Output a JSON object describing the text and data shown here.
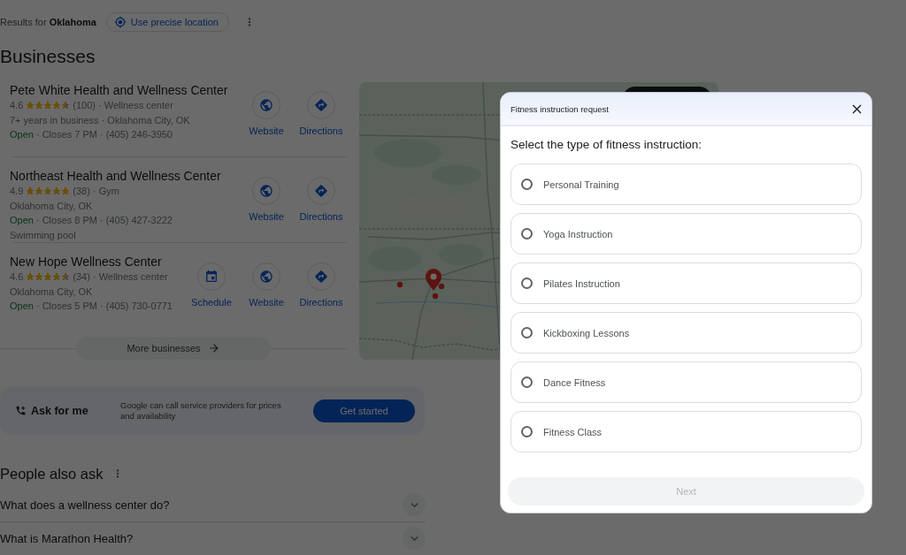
{
  "location_bar": {
    "text": "Results for **Oklahoma**",
    "precise_button": "Use precise location"
  },
  "businesses_heading": "Businesses",
  "businesses": [
    {
      "name": "Pete White Health and Wellness Center",
      "rating": "4.6",
      "stars": 4.5,
      "review_line": "(100) · Wellness center",
      "lines": [
        {
          "kind": "text",
          "text": "7+ years in business · Oklahoma City, OK"
        },
        {
          "kind": "hours",
          "status": "Open",
          "open": true,
          "text": "· Closes 7 PM · (405) 246-3950"
        }
      ],
      "actions": [
        {
          "kind": "website",
          "label": "Website"
        },
        {
          "kind": "directions",
          "label": "Directions"
        }
      ]
    },
    {
      "name": "Northeast Health and Wellness Center",
      "rating": "4.9",
      "stars": 5,
      "review_line": "(38) · Gym",
      "lines": [
        {
          "kind": "text",
          "text": "Oklahoma City, OK"
        },
        {
          "kind": "hours",
          "status": "Open",
          "open": true,
          "text": "· Closes 8 PM · (405) 427-3222"
        },
        {
          "kind": "text",
          "text": "Swimming pool"
        }
      ],
      "actions": [
        {
          "kind": "website",
          "label": "Website"
        },
        {
          "kind": "directions",
          "label": "Directions"
        }
      ]
    },
    {
      "name": "New Hope Wellness Center",
      "rating": "4.6",
      "stars": 4.5,
      "review_line": "(34) · Wellness center",
      "lines": [
        {
          "kind": "text",
          "text": "Oklahoma City, OK"
        },
        {
          "kind": "hours",
          "status": "Open",
          "open": true,
          "text": "· Closes 5 PM · (405) 730-0771"
        }
      ],
      "actions": [
        {
          "kind": "schedule",
          "label": "Schedule"
        },
        {
          "kind": "website",
          "label": "Website"
        },
        {
          "kind": "directions",
          "label": "Directions"
        }
      ]
    }
  ],
  "more_businesses_button": "More businesses",
  "ask_for_me": {
    "title": "Ask for me",
    "description": "Google can call service providers for prices and availability",
    "button": "Get started"
  },
  "people_also_ask": {
    "heading": "People also ask",
    "questions": [
      {
        "text": "What does a wellness center do?",
        "expanded": false
      },
      {
        "text": "What is Marathon Health?",
        "expanded": false
      }
    ]
  },
  "dialog": {
    "title": "Fitness instruction request",
    "prompt": "Select the type of fitness instruction:",
    "options": [
      {
        "label": "Personal Training",
        "selected": false
      },
      {
        "label": "Yoga Instruction",
        "selected": false
      },
      {
        "label": "Pilates Instruction",
        "selected": false
      },
      {
        "label": "Kickboxing Lessons",
        "selected": false
      },
      {
        "label": "Dance Fitness",
        "selected": false
      },
      {
        "label": "Fitness Class",
        "selected": false
      }
    ],
    "next_button": {
      "label": "Next",
      "disabled": true
    }
  }
}
